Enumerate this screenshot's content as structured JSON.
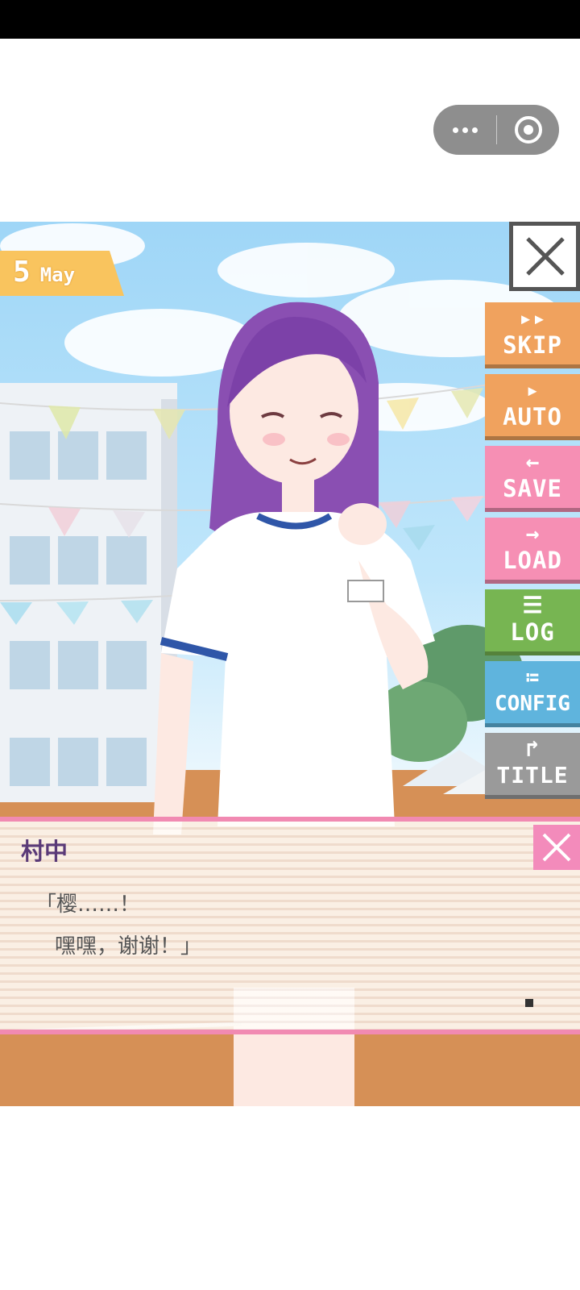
{
  "capsule": {
    "more_icon": "more-dots-icon",
    "close_icon": "target-close-icon"
  },
  "date": {
    "day": "5",
    "month": "May"
  },
  "menu": [
    {
      "id": "skip",
      "label": "SKIP",
      "glyph": "▸▸",
      "color": "#f0a25e"
    },
    {
      "id": "auto",
      "label": "AUTO",
      "glyph": "▸",
      "color": "#f0a25e"
    },
    {
      "id": "save",
      "label": "SAVE",
      "glyph": "←",
      "color": "#f68fb4"
    },
    {
      "id": "load",
      "label": "LOAD",
      "glyph": "→",
      "color": "#f68fb4"
    },
    {
      "id": "log",
      "label": "LOG",
      "glyph": "☰",
      "color": "#77b552"
    },
    {
      "id": "config",
      "label": "CONFIG",
      "glyph": "≔",
      "color": "#5fb4dd"
    },
    {
      "id": "title",
      "label": "TITLE",
      "glyph": "↱",
      "color": "#9a9a9a"
    }
  ],
  "dialog": {
    "speaker": "村中",
    "line1": "「樱……！",
    "line2": "嘿嘿，谢谢！」"
  },
  "colors": {
    "accent_pink": "#f18ab2",
    "date_tab": "#f9c45e",
    "speaker": "#5a3a78"
  }
}
